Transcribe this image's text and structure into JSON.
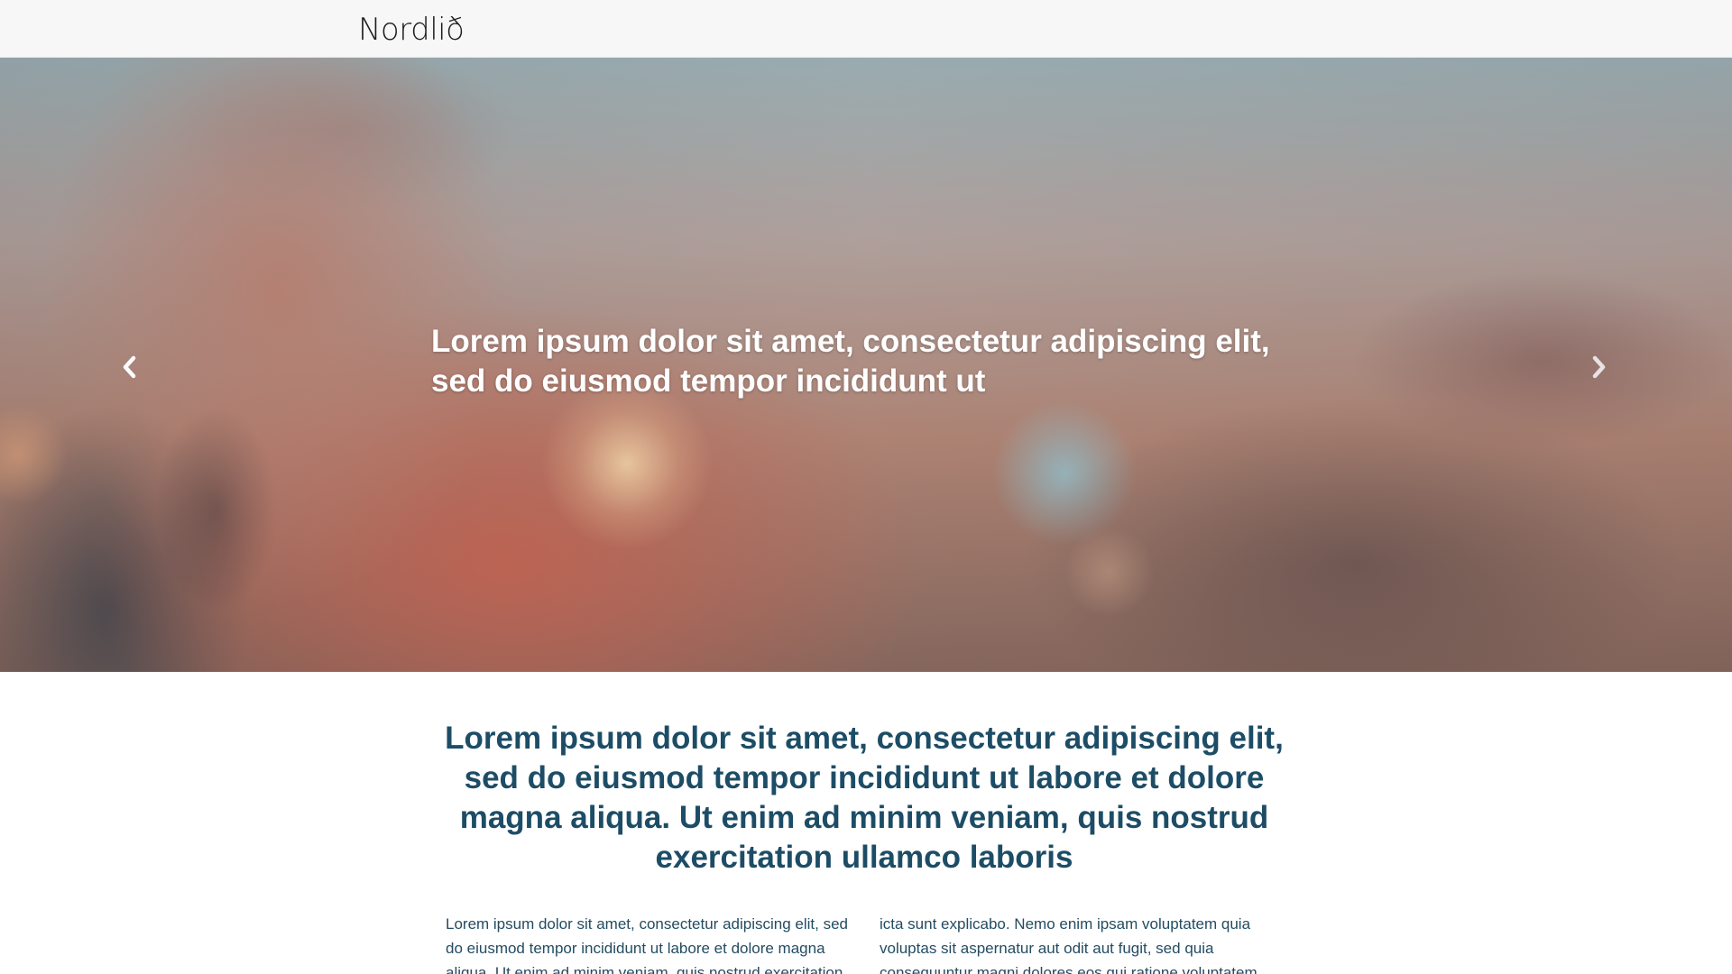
{
  "header": {
    "logo_text": "Nordlið"
  },
  "hero": {
    "caption": "Lorem ipsum dolor sit amet, consectetur adipiscing elit, sed do eiusmod tempor incididunt ut",
    "prev_icon": "chevron-left-icon",
    "next_icon": "chevron-right-icon"
  },
  "intro": {
    "heading": "Lorem ipsum dolor sit amet, consectetur adipiscing elit, sed do eiusmod tempor incididunt ut labore et dolore magna aliqua. Ut enim ad minim veniam, quis nostrud exercitation ullamco laboris",
    "column_left": "Lorem ipsum dolor sit amet, consectetur adipiscing elit, sed do eiusmod tempor incididunt ut labore et dolore magna aliqua. Ut enim ad minim veniam, quis nostrud exercitation ullamco",
    "column_right": "icta sunt explicabo. Nemo enim ipsam voluptatem quia voluptas sit aspernatur aut odit aut fugit, sed quia consequuntur magni dolores eos qui ratione voluptatem sequi"
  },
  "colors": {
    "header_bg": "#f7f7f8",
    "heading_text": "#1d4d66",
    "body_text": "#244c62",
    "hero_caption_text": "#ffffff"
  }
}
